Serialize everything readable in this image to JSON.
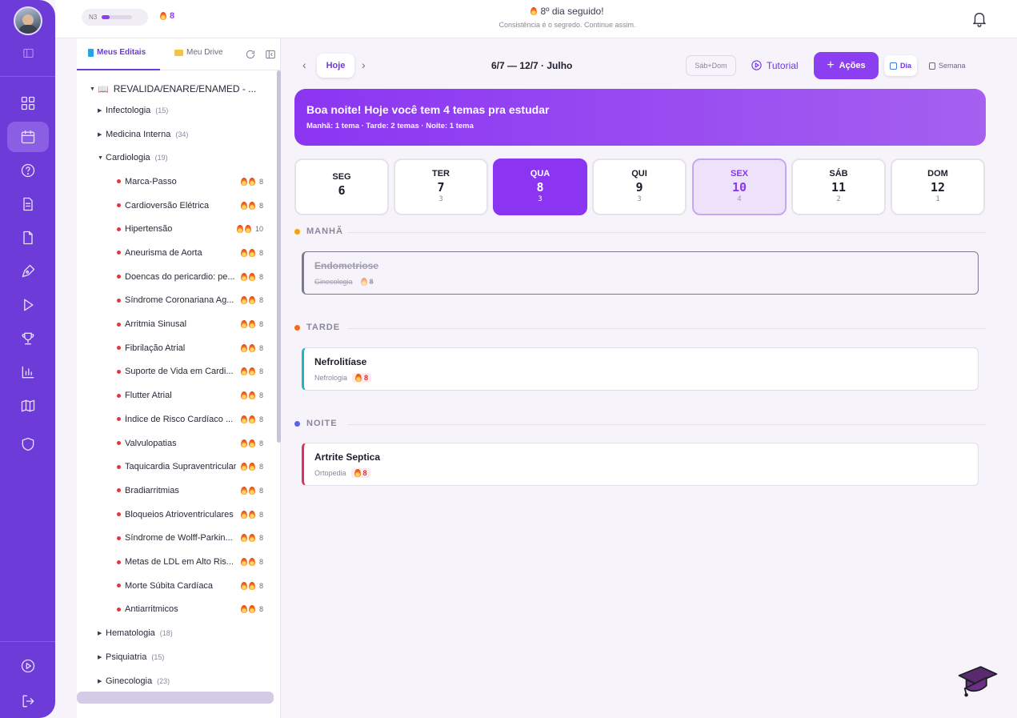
{
  "topbar": {
    "level": "N3",
    "level_progress": 0.25,
    "streak": "8",
    "message": "8º dia seguido!",
    "submessage": "Consistência é o segredo. Continue assim."
  },
  "panel": {
    "tab_editais": "Meus Editais",
    "tab_drive": "Meu Drive",
    "root": "REVALIDA/ENARE/ENAMED - ...",
    "categories_top": [
      {
        "name": "Infectologia",
        "count": "(15)"
      },
      {
        "name": "Medicina Interna",
        "count": "(34)"
      },
      {
        "name": "Cardiologia",
        "count": "(19)"
      }
    ],
    "topics": [
      {
        "name": "Marca-Passo",
        "value": "8"
      },
      {
        "name": "Cardioversão Elétrica",
        "value": "8"
      },
      {
        "name": "Hipertensão",
        "value": "10"
      },
      {
        "name": "Aneurisma de Aorta",
        "value": "8"
      },
      {
        "name": "Doencas do pericardio: pe...",
        "value": "8"
      },
      {
        "name": "Síndrome Coronariana Ag...",
        "value": "8"
      },
      {
        "name": "Arritmia Sinusal",
        "value": "8"
      },
      {
        "name": "Fibrilação Atrial",
        "value": "8"
      },
      {
        "name": "Suporte de Vida em Cardi...",
        "value": "8"
      },
      {
        "name": "Flutter Atrial",
        "value": "8"
      },
      {
        "name": "Índice de Risco Cardíaco ...",
        "value": "8"
      },
      {
        "name": "Valvulopatias",
        "value": "8"
      },
      {
        "name": "Taquicardia Supraventricular",
        "value": "8"
      },
      {
        "name": "Bradiarritmias",
        "value": "8"
      },
      {
        "name": "Bloqueios Atrioventriculares",
        "value": "8"
      },
      {
        "name": "Síndrome de Wolff-Parkin...",
        "value": "8"
      },
      {
        "name": "Metas de LDL em Alto Ris...",
        "value": "8"
      },
      {
        "name": "Morte Súbita Cardíaca",
        "value": "8"
      },
      {
        "name": "Antiarritmicos",
        "value": "8"
      }
    ],
    "categories_bottom": [
      {
        "name": "Hematologia",
        "count": "(18)"
      },
      {
        "name": "Psiquiatria",
        "count": "(15)"
      },
      {
        "name": "Ginecologia",
        "count": "(23)"
      }
    ]
  },
  "toolbar": {
    "today": "Hoje",
    "range": "6/7 — 12/7 · Julho",
    "weekend": "Sáb+Dom",
    "tutorial": "Tutorial",
    "actions": "Ações",
    "view_day": "Dia",
    "view_week": "Semana"
  },
  "banner": {
    "title": "Boa noite! Hoje você tem 4 temas pra estudar",
    "subtitle": "Manhã: 1 tema · Tarde: 2 temas · Noite: 1 tema"
  },
  "days": [
    {
      "name": "SEG",
      "num": "6",
      "count": ""
    },
    {
      "name": "TER",
      "num": "7",
      "count": "3"
    },
    {
      "name": "QUA",
      "num": "8",
      "count": "3"
    },
    {
      "name": "QUI",
      "num": "9",
      "count": "3"
    },
    {
      "name": "SEX",
      "num": "10",
      "count": "4"
    },
    {
      "name": "SÁB",
      "num": "11",
      "count": "2"
    },
    {
      "name": "DOM",
      "num": "12",
      "count": "1"
    }
  ],
  "sections": {
    "morning": "MANHÃ",
    "afternoon": "TARDE",
    "night": "NOITE"
  },
  "cards": {
    "morning": {
      "title": "Endometriose",
      "subject": "Ginecologia",
      "value": "8"
    },
    "afternoon": {
      "title": "Nefrolitíase",
      "subject": "Nefrologia",
      "value": "8"
    },
    "night": {
      "title": "Artrite Septica",
      "subject": "Ortopedia",
      "value": "8"
    }
  },
  "colors": {
    "accent": "#8b3ff0",
    "rail": "#6d3bd8",
    "morning": "#f2a20c",
    "afternoon": "#f26a1b",
    "night": "#5b63e6",
    "card_afternoon": "#1fb5c9",
    "card_night": "#e0305a"
  }
}
